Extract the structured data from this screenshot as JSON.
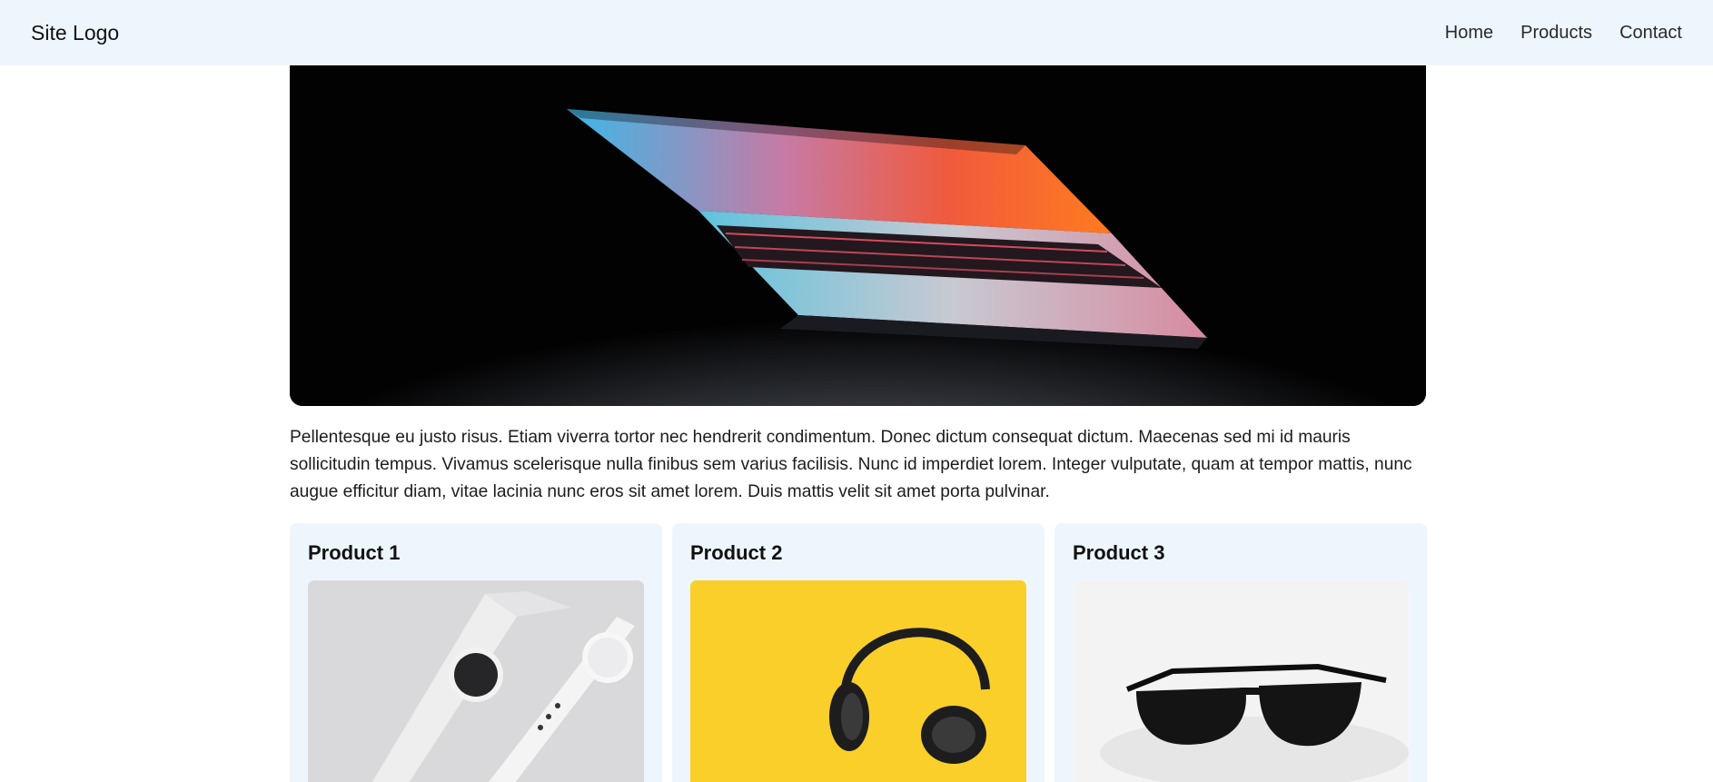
{
  "header": {
    "logo": "Site Logo",
    "nav": [
      {
        "label": "Home"
      },
      {
        "label": "Products"
      },
      {
        "label": "Contact"
      }
    ]
  },
  "hero": {
    "image": "laptop-photo"
  },
  "intro": {
    "text": "Pellentesque eu justo risus. Etiam viverra tortor nec hendrerit condimentum. Donec dictum consequat dictum. Maecenas sed mi id mauris sollicitudin tempus. Vivamus scelerisque nulla finibus sem varius facilisis. Nunc id imperdiet lorem. Integer vulputate, quam at tempor mattis, nunc augue efficitur diam, vitae lacinia nunc eros sit amet lorem. Duis mattis velit sit amet porta pulvinar."
  },
  "products": [
    {
      "title": "Product 1",
      "image": "watch-photo"
    },
    {
      "title": "Product 2",
      "image": "headphones-photo"
    },
    {
      "title": "Product 3",
      "image": "sunglasses-photo"
    }
  ],
  "colors": {
    "nav_background": "#eef6fd",
    "card_background": "#eef6fd",
    "headphones_background": "#f9c80e"
  }
}
